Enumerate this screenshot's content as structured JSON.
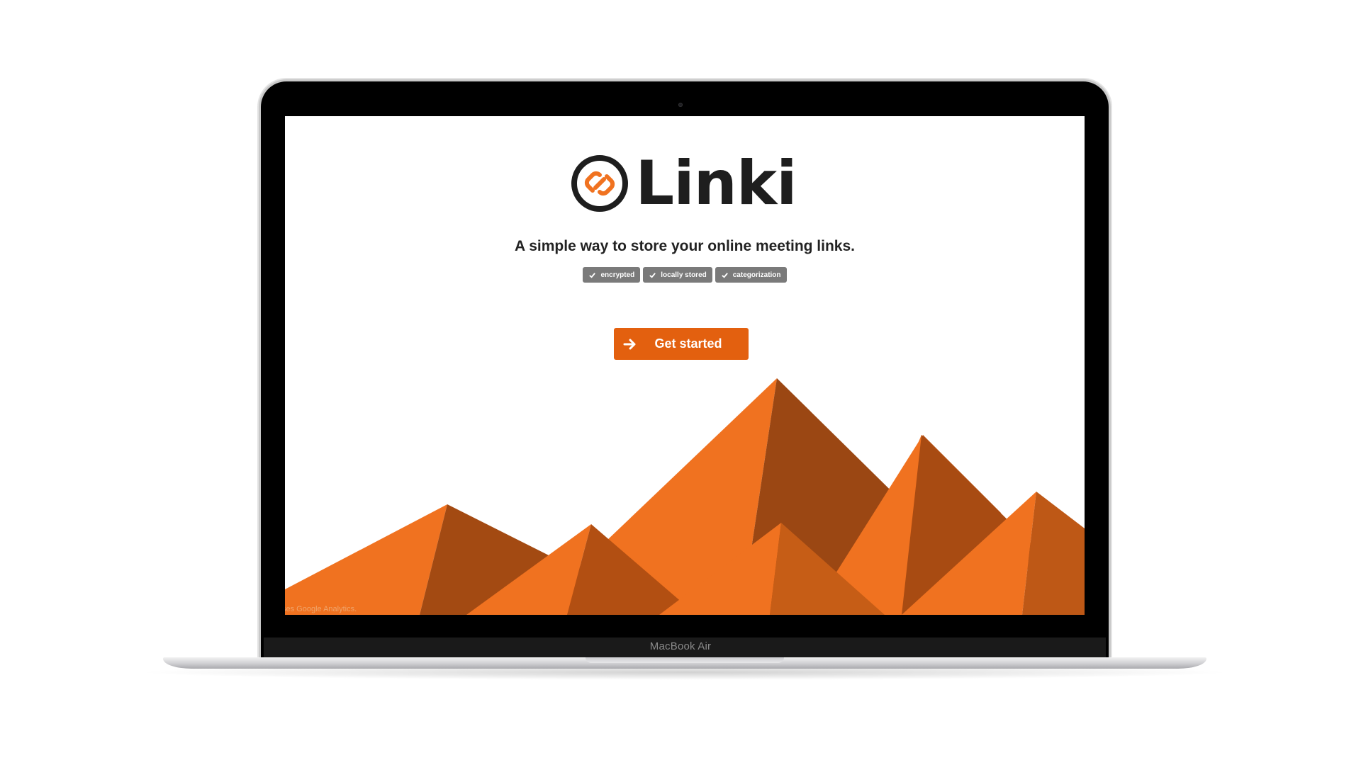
{
  "device": {
    "model_label": "MacBook Air"
  },
  "app": {
    "name": "Linki",
    "tagline": "A simple way to store your online meeting links.",
    "badges": [
      {
        "label": "encrypted",
        "icon": "check-icon"
      },
      {
        "label": "locally stored",
        "icon": "check-icon"
      },
      {
        "label": "categorization",
        "icon": "check-icon"
      }
    ],
    "cta": {
      "label": "Get started",
      "icon": "arrow-right-icon"
    },
    "footer_note": "ses Google Analytics."
  },
  "colors": {
    "accent": "#e3600f",
    "mountain_light": "#f07220",
    "mountain_dark": "#9c4813",
    "badge_bg": "#7a7a7a",
    "text_dark": "#1e1e1e"
  }
}
